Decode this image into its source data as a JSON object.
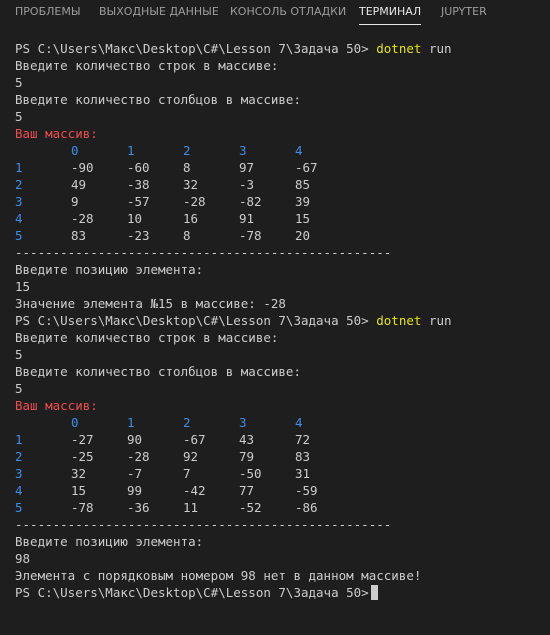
{
  "tabs": [
    {
      "label": "ПРОБЛЕМЫ",
      "active": false
    },
    {
      "label": "ВЫХОДНЫЕ ДАННЫЕ",
      "active": false
    },
    {
      "label": "КОНСОЛЬ ОТЛАДКИ",
      "active": false
    },
    {
      "label": "ТЕРМИНАЛ",
      "active": true
    },
    {
      "label": "JUPYTER",
      "active": false
    }
  ],
  "terminal": {
    "prompt": "PS C:\\Users\\Макс\\Desktop\\C#\\Lesson 7\\Задача 50>",
    "command_name": "dotnet",
    "command_args": "run",
    "ask_rows": "Введите количество строк в массиве:",
    "ask_cols": "Введите количество столбцов в массиве:",
    "array_label": "Ваш массив:",
    "separator": "--------------------------------------------------",
    "ask_position": "Введите позицию элемента:",
    "run1": {
      "rows_input": "5",
      "cols_input": "5",
      "col_headers": [
        "0",
        "1",
        "2",
        "3",
        "4"
      ],
      "rows": [
        {
          "index": "1",
          "values": [
            "-90",
            "-60",
            "8",
            "97",
            "-67"
          ]
        },
        {
          "index": "2",
          "values": [
            "49",
            "-38",
            "32",
            "-3",
            "85"
          ]
        },
        {
          "index": "3",
          "values": [
            "9",
            "-57",
            "-28",
            "-82",
            "39"
          ]
        },
        {
          "index": "4",
          "values": [
            "-28",
            "10",
            "16",
            "91",
            "15"
          ]
        },
        {
          "index": "5",
          "values": [
            "83",
            "-23",
            "8",
            "-78",
            "20"
          ]
        }
      ],
      "position_input": "15",
      "result": "Значение элемента №15 в массиве: -28"
    },
    "run2": {
      "rows_input": "5",
      "cols_input": "5",
      "col_headers": [
        "0",
        "1",
        "2",
        "3",
        "4"
      ],
      "rows": [
        {
          "index": "1",
          "values": [
            "-27",
            "90",
            "-67",
            "43",
            "72"
          ]
        },
        {
          "index": "2",
          "values": [
            "-25",
            "-28",
            "92",
            "79",
            "83"
          ]
        },
        {
          "index": "3",
          "values": [
            "32",
            "-7",
            "7",
            "-50",
            "31"
          ]
        },
        {
          "index": "4",
          "values": [
            "15",
            "99",
            "-42",
            "77",
            "-59"
          ]
        },
        {
          "index": "5",
          "values": [
            "-78",
            "-36",
            "11",
            "-52",
            "-86"
          ]
        }
      ],
      "position_input": "98",
      "result": "Элемента с порядковым номером 98 нет в данном массиве!"
    }
  }
}
